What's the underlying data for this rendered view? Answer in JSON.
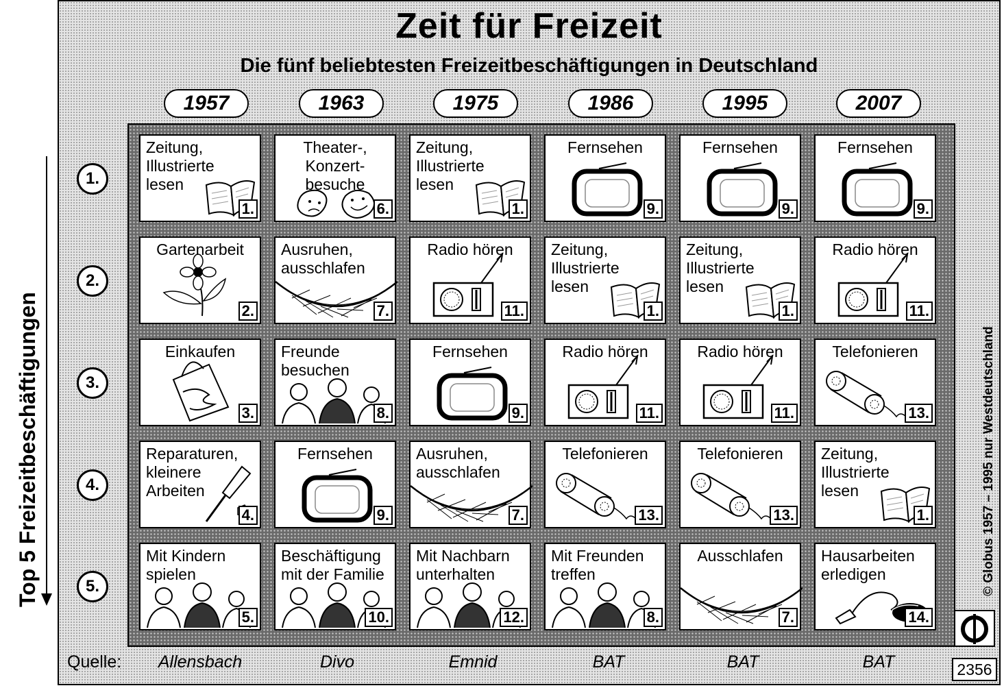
{
  "title": "Zeit für Freizeit",
  "subtitle": "Die fünf beliebtesten Freizeitbeschäftigungen in Deutschland",
  "side_label": "Top 5 Freizeitbeschäftigungen",
  "credit": "© Globus   1957 – 1995  nur Westdeutschland",
  "source_label": "Quelle:",
  "logo_number": "2356",
  "years": [
    "1957",
    "1963",
    "1975",
    "1986",
    "1995",
    "2007"
  ],
  "row_ranks": [
    "1.",
    "2.",
    "3.",
    "4.",
    "5."
  ],
  "sources": [
    "Allensbach",
    "Divo",
    "Emnid",
    "BAT",
    "BAT",
    "BAT"
  ],
  "grid": [
    [
      {
        "label": "Zeitung,\nIllustrierte\nlesen",
        "rank": "1.",
        "icon": "newspaper-icon"
      },
      {
        "label": "Theater-,\nKonzert-\nbesuche",
        "rank": "6.",
        "icon": "theater-masks-icon"
      },
      {
        "label": "Zeitung,\nIllustrierte\nlesen",
        "rank": "1.",
        "icon": "newspaper-icon"
      },
      {
        "label": "Fernsehen",
        "rank": "9.",
        "icon": "tv-icon"
      },
      {
        "label": "Fernsehen",
        "rank": "9.",
        "icon": "tv-icon"
      },
      {
        "label": "Fernsehen",
        "rank": "9.",
        "icon": "tv-icon"
      }
    ],
    [
      {
        "label": "Gartenarbeit",
        "rank": "2.",
        "icon": "flower-icon"
      },
      {
        "label": "Ausruhen,\nausschlafen",
        "rank": "7.",
        "icon": "hammock-icon"
      },
      {
        "label": "Radio hören",
        "rank": "11.",
        "icon": "radio-icon"
      },
      {
        "label": "Zeitung,\nIllustrierte\nlesen",
        "rank": "1.",
        "icon": "newspaper-icon"
      },
      {
        "label": "Zeitung,\nIllustrierte\nlesen",
        "rank": "1.",
        "icon": "newspaper-icon"
      },
      {
        "label": "Radio hören",
        "rank": "11.",
        "icon": "radio-icon"
      }
    ],
    [
      {
        "label": "Einkaufen",
        "rank": "3.",
        "icon": "shopping-bag-icon"
      },
      {
        "label": "Freunde\nbesuchen",
        "rank": "8.",
        "icon": "people-icon"
      },
      {
        "label": "Fernsehen",
        "rank": "9.",
        "icon": "tv-icon"
      },
      {
        "label": "Radio hören",
        "rank": "11.",
        "icon": "radio-icon"
      },
      {
        "label": "Radio hören",
        "rank": "11.",
        "icon": "radio-icon"
      },
      {
        "label": "Telefonieren",
        "rank": "13.",
        "icon": "phone-icon"
      }
    ],
    [
      {
        "label": "Reparaturen,\nkleinere\nArbeiten",
        "rank": "4.",
        "icon": "screwdriver-icon"
      },
      {
        "label": "Fernsehen",
        "rank": "9.",
        "icon": "tv-icon"
      },
      {
        "label": "Ausruhen,\nausschlafen",
        "rank": "7.",
        "icon": "hammock-icon"
      },
      {
        "label": "Telefonieren",
        "rank": "13.",
        "icon": "phone-icon"
      },
      {
        "label": "Telefonieren",
        "rank": "13.",
        "icon": "phone-icon"
      },
      {
        "label": "Zeitung,\nIllustrierte\nlesen",
        "rank": "1.",
        "icon": "newspaper-icon"
      }
    ],
    [
      {
        "label": "Mit Kindern\nspielen",
        "rank": "5.",
        "icon": "people-icon"
      },
      {
        "label": "Beschäftigung\nmit der Familie",
        "rank": "10.",
        "icon": "people-icon"
      },
      {
        "label": "Mit Nachbarn\nunterhalten",
        "rank": "12.",
        "icon": "people-icon"
      },
      {
        "label": "Mit Freunden\ntreffen",
        "rank": "8.",
        "icon": "people-icon"
      },
      {
        "label": "Ausschlafen",
        "rank": "7.",
        "icon": "hammock-icon"
      },
      {
        "label": "Hausarbeiten\nerledigen",
        "rank": "14.",
        "icon": "vacuum-icon"
      }
    ]
  ]
}
